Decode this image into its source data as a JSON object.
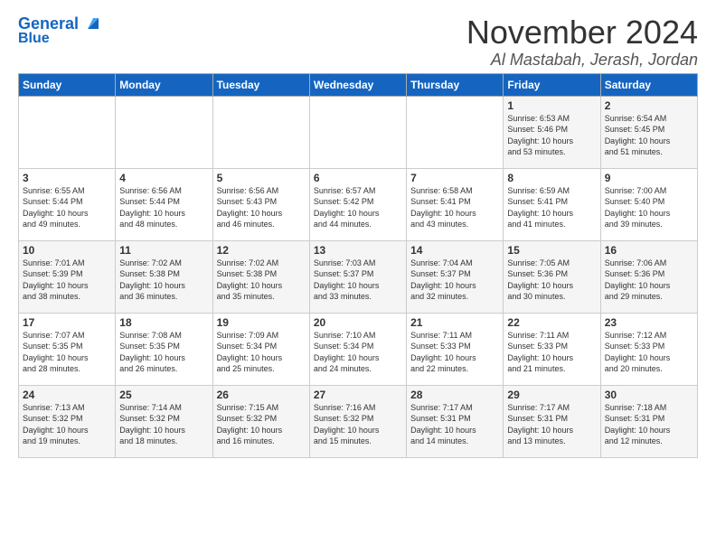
{
  "logo": {
    "general": "General",
    "blue": "Blue"
  },
  "header": {
    "month": "November 2024",
    "location": "Al Mastabah, Jerash, Jordan"
  },
  "days_of_week": [
    "Sunday",
    "Monday",
    "Tuesday",
    "Wednesday",
    "Thursday",
    "Friday",
    "Saturday"
  ],
  "weeks": [
    [
      {
        "day": "",
        "info": ""
      },
      {
        "day": "",
        "info": ""
      },
      {
        "day": "",
        "info": ""
      },
      {
        "day": "",
        "info": ""
      },
      {
        "day": "",
        "info": ""
      },
      {
        "day": "1",
        "info": "Sunrise: 6:53 AM\nSunset: 5:46 PM\nDaylight: 10 hours\nand 53 minutes."
      },
      {
        "day": "2",
        "info": "Sunrise: 6:54 AM\nSunset: 5:45 PM\nDaylight: 10 hours\nand 51 minutes."
      }
    ],
    [
      {
        "day": "3",
        "info": "Sunrise: 6:55 AM\nSunset: 5:44 PM\nDaylight: 10 hours\nand 49 minutes."
      },
      {
        "day": "4",
        "info": "Sunrise: 6:56 AM\nSunset: 5:44 PM\nDaylight: 10 hours\nand 48 minutes."
      },
      {
        "day": "5",
        "info": "Sunrise: 6:56 AM\nSunset: 5:43 PM\nDaylight: 10 hours\nand 46 minutes."
      },
      {
        "day": "6",
        "info": "Sunrise: 6:57 AM\nSunset: 5:42 PM\nDaylight: 10 hours\nand 44 minutes."
      },
      {
        "day": "7",
        "info": "Sunrise: 6:58 AM\nSunset: 5:41 PM\nDaylight: 10 hours\nand 43 minutes."
      },
      {
        "day": "8",
        "info": "Sunrise: 6:59 AM\nSunset: 5:41 PM\nDaylight: 10 hours\nand 41 minutes."
      },
      {
        "day": "9",
        "info": "Sunrise: 7:00 AM\nSunset: 5:40 PM\nDaylight: 10 hours\nand 39 minutes."
      }
    ],
    [
      {
        "day": "10",
        "info": "Sunrise: 7:01 AM\nSunset: 5:39 PM\nDaylight: 10 hours\nand 38 minutes."
      },
      {
        "day": "11",
        "info": "Sunrise: 7:02 AM\nSunset: 5:38 PM\nDaylight: 10 hours\nand 36 minutes."
      },
      {
        "day": "12",
        "info": "Sunrise: 7:02 AM\nSunset: 5:38 PM\nDaylight: 10 hours\nand 35 minutes."
      },
      {
        "day": "13",
        "info": "Sunrise: 7:03 AM\nSunset: 5:37 PM\nDaylight: 10 hours\nand 33 minutes."
      },
      {
        "day": "14",
        "info": "Sunrise: 7:04 AM\nSunset: 5:37 PM\nDaylight: 10 hours\nand 32 minutes."
      },
      {
        "day": "15",
        "info": "Sunrise: 7:05 AM\nSunset: 5:36 PM\nDaylight: 10 hours\nand 30 minutes."
      },
      {
        "day": "16",
        "info": "Sunrise: 7:06 AM\nSunset: 5:36 PM\nDaylight: 10 hours\nand 29 minutes."
      }
    ],
    [
      {
        "day": "17",
        "info": "Sunrise: 7:07 AM\nSunset: 5:35 PM\nDaylight: 10 hours\nand 28 minutes."
      },
      {
        "day": "18",
        "info": "Sunrise: 7:08 AM\nSunset: 5:35 PM\nDaylight: 10 hours\nand 26 minutes."
      },
      {
        "day": "19",
        "info": "Sunrise: 7:09 AM\nSunset: 5:34 PM\nDaylight: 10 hours\nand 25 minutes."
      },
      {
        "day": "20",
        "info": "Sunrise: 7:10 AM\nSunset: 5:34 PM\nDaylight: 10 hours\nand 24 minutes."
      },
      {
        "day": "21",
        "info": "Sunrise: 7:11 AM\nSunset: 5:33 PM\nDaylight: 10 hours\nand 22 minutes."
      },
      {
        "day": "22",
        "info": "Sunrise: 7:11 AM\nSunset: 5:33 PM\nDaylight: 10 hours\nand 21 minutes."
      },
      {
        "day": "23",
        "info": "Sunrise: 7:12 AM\nSunset: 5:33 PM\nDaylight: 10 hours\nand 20 minutes."
      }
    ],
    [
      {
        "day": "24",
        "info": "Sunrise: 7:13 AM\nSunset: 5:32 PM\nDaylight: 10 hours\nand 19 minutes."
      },
      {
        "day": "25",
        "info": "Sunrise: 7:14 AM\nSunset: 5:32 PM\nDaylight: 10 hours\nand 18 minutes."
      },
      {
        "day": "26",
        "info": "Sunrise: 7:15 AM\nSunset: 5:32 PM\nDaylight: 10 hours\nand 16 minutes."
      },
      {
        "day": "27",
        "info": "Sunrise: 7:16 AM\nSunset: 5:32 PM\nDaylight: 10 hours\nand 15 minutes."
      },
      {
        "day": "28",
        "info": "Sunrise: 7:17 AM\nSunset: 5:31 PM\nDaylight: 10 hours\nand 14 minutes."
      },
      {
        "day": "29",
        "info": "Sunrise: 7:17 AM\nSunset: 5:31 PM\nDaylight: 10 hours\nand 13 minutes."
      },
      {
        "day": "30",
        "info": "Sunrise: 7:18 AM\nSunset: 5:31 PM\nDaylight: 10 hours\nand 12 minutes."
      }
    ]
  ]
}
